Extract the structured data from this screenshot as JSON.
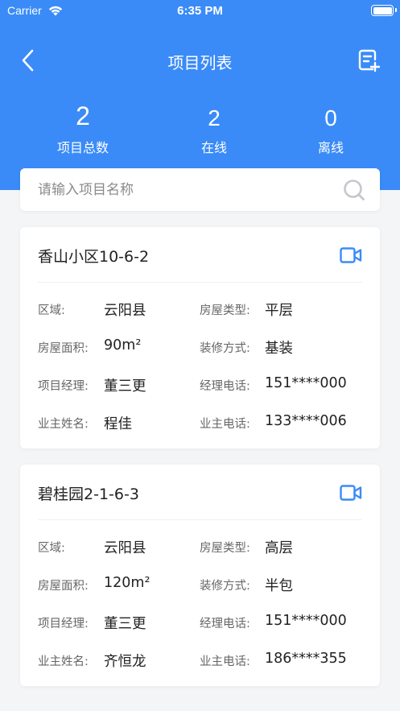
{
  "status_bar": {
    "carrier": "Carrier",
    "time": "6:35 PM"
  },
  "nav": {
    "title": "项目列表"
  },
  "stats": [
    {
      "value": "2",
      "label": "项目总数"
    },
    {
      "value": "2",
      "label": "在线"
    },
    {
      "value": "0",
      "label": "离线"
    }
  ],
  "search": {
    "placeholder": "请输入项目名称",
    "value": ""
  },
  "projects": [
    {
      "name": "香山小区10-6-2",
      "rows": [
        [
          "区域:",
          "云阳县",
          "房屋类型:",
          "平层"
        ],
        [
          "房屋面积:",
          "90m²",
          "装修方式:",
          "基装"
        ],
        [
          "项目经理:",
          "董三更",
          "经理电话:",
          "151****000"
        ],
        [
          "业主姓名:",
          "程佳",
          "业主电话:",
          "133****006"
        ]
      ]
    },
    {
      "name": "碧桂园2-1-6-3",
      "rows": [
        [
          "区域:",
          "云阳县",
          "房屋类型:",
          "高层"
        ],
        [
          "房屋面积:",
          "120m²",
          "装修方式:",
          "半包"
        ],
        [
          "项目经理:",
          "董三更",
          "经理电话:",
          "151****000"
        ],
        [
          "业主姓名:",
          "齐恒龙",
          "业主电话:",
          "186****355"
        ]
      ]
    }
  ],
  "colors": {
    "primary": "#3a8bf7",
    "background": "#f4f5f7",
    "card": "#ffffff"
  },
  "icons": {
    "back": "chevron-left-icon",
    "add": "add-document-icon",
    "search": "search-icon",
    "video": "video-camera-icon",
    "wifi": "wifi-icon",
    "battery": "battery-icon"
  }
}
